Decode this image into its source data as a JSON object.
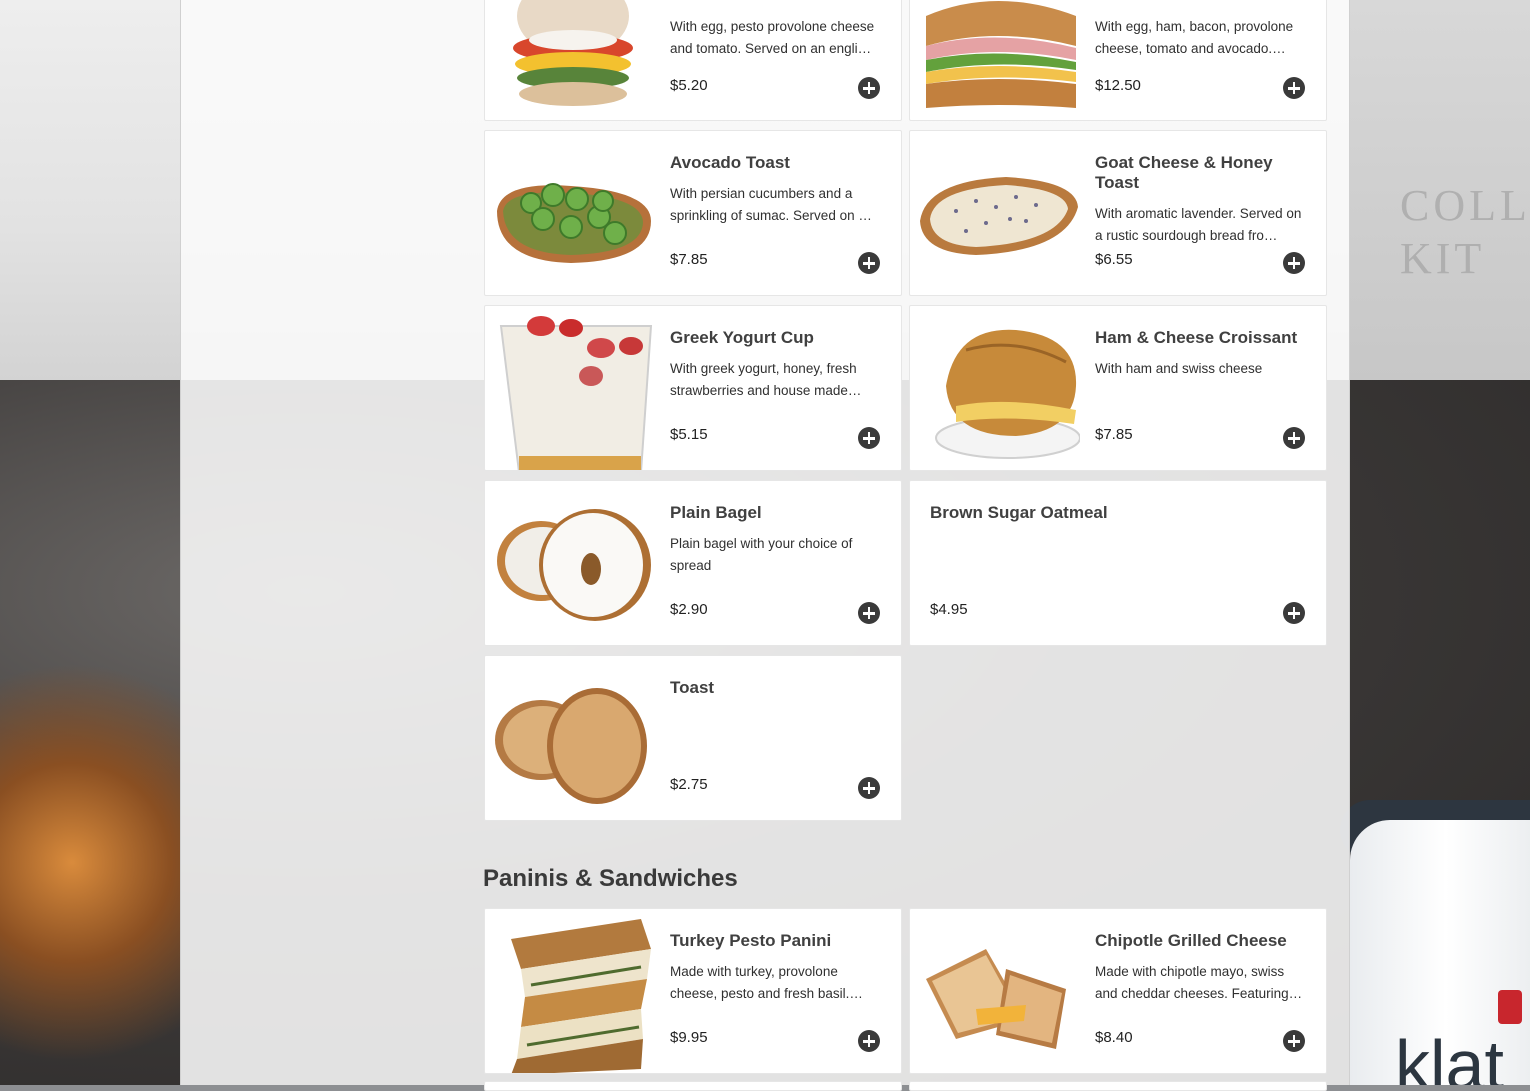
{
  "breakfast_items": [
    {
      "name": "",
      "description": "With egg, pesto provolone cheese and tomato. Served on an engli…",
      "price": "$5.20",
      "image": "egg-muffin-image"
    },
    {
      "name": "",
      "description": "With egg, ham, bacon, provolone cheese, tomato and avocado.…",
      "price": "$12.50",
      "image": "club-sandwich-image"
    },
    {
      "name": "Avocado Toast",
      "description": "With persian cucumbers and a sprinkling of sumac. Served on …",
      "price": "$7.85",
      "image": "avocado-toast-image"
    },
    {
      "name": "Goat Cheese & Honey Toast",
      "description": "With aromatic lavender. Served on a rustic sourdough bread fro…",
      "price": "$6.55",
      "image": "goat-cheese-toast-image"
    },
    {
      "name": "Greek Yogurt Cup",
      "description": "With greek yogurt, honey, fresh strawberries and house made…",
      "price": "$5.15",
      "image": "yogurt-cup-image"
    },
    {
      "name": "Ham & Cheese Croissant",
      "description": "With ham and swiss cheese",
      "price": "$7.85",
      "image": "croissant-image"
    },
    {
      "name": "Plain Bagel",
      "description": "Plain bagel with your choice of spread",
      "price": "$2.90",
      "image": "bagel-image"
    },
    {
      "name": "Brown Sugar Oatmeal",
      "description": "",
      "price": "$4.95",
      "image": ""
    },
    {
      "name": "Toast",
      "description": "",
      "price": "$2.75",
      "image": "toast-image"
    }
  ],
  "sections": {
    "paninis_title": "Paninis & Sandwiches"
  },
  "panini_items": [
    {
      "name": "Turkey Pesto Panini",
      "description": "Made with turkey, provolone cheese, pesto and fresh basil.…",
      "price": "$9.95",
      "image": "panini-image"
    },
    {
      "name": "Chipotle Grilled Cheese",
      "description": "Made with chipotle mayo, swiss and cheddar cheeses. Featuring…",
      "price": "$8.40",
      "image": "grilled-cheese-image"
    }
  ],
  "background": {
    "cup_text": "klat"
  },
  "colors": {
    "add_button": "#3a3a3a",
    "card_bg": "#ffffff",
    "title_text": "#404040"
  }
}
